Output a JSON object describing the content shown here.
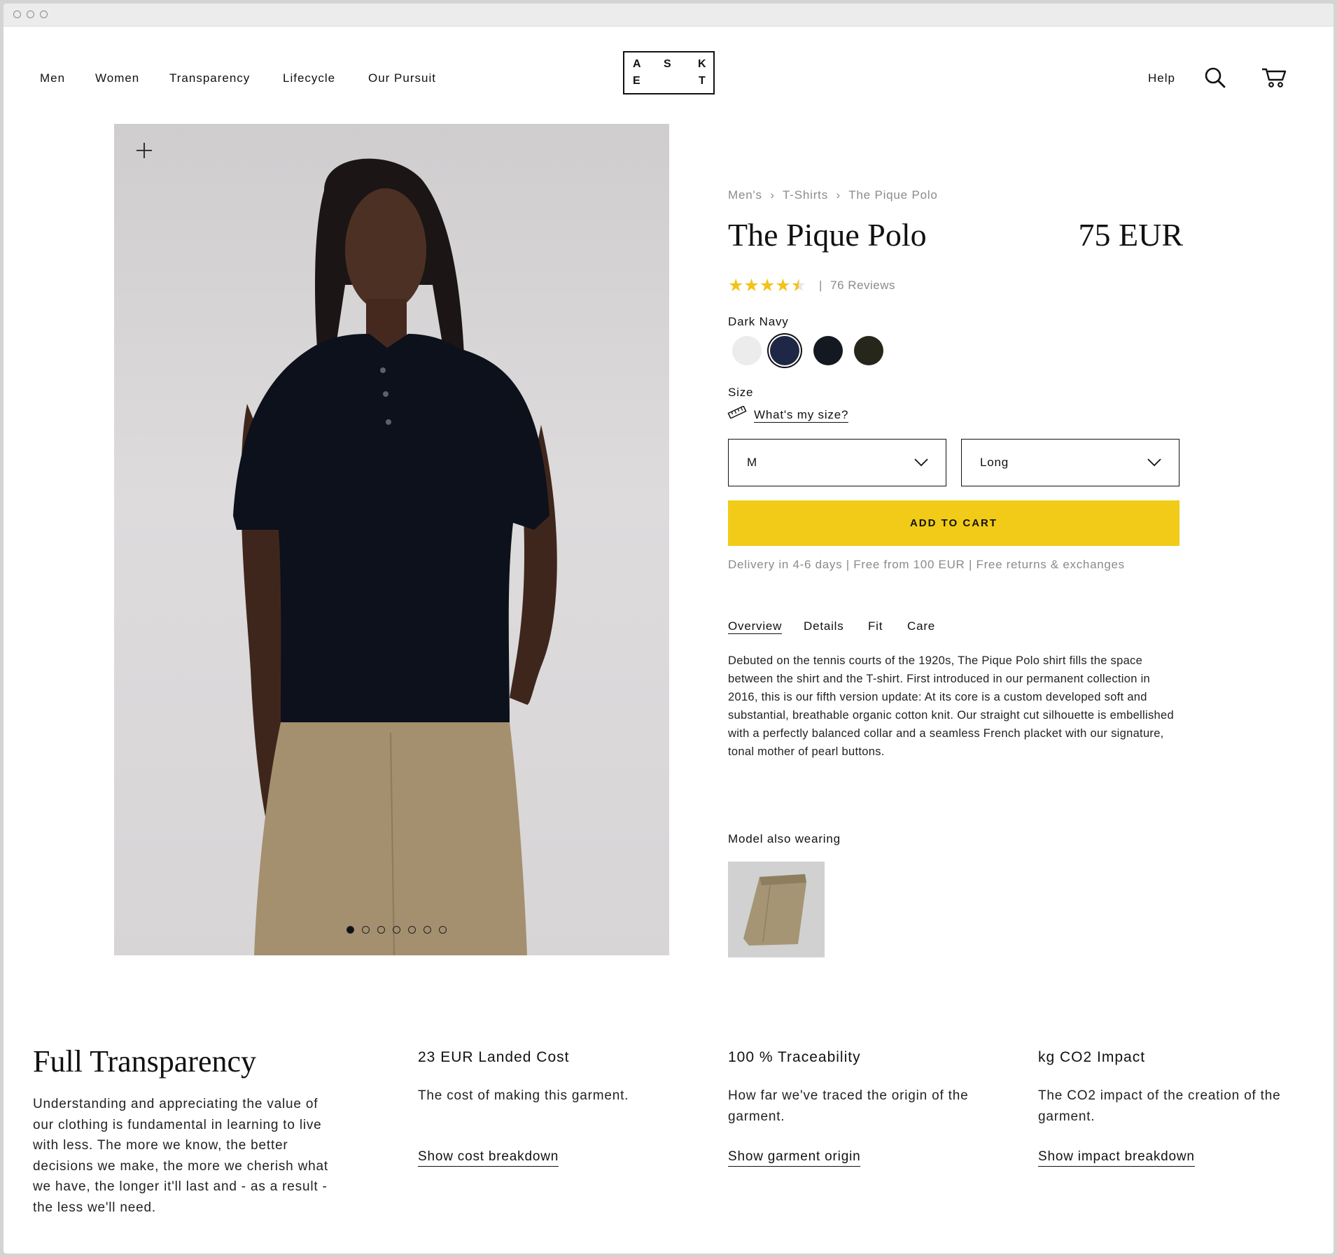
{
  "nav": {
    "links": [
      "Men",
      "Women",
      "Transparency",
      "Lifecycle",
      "Our Pursuit"
    ],
    "help": "Help",
    "search_icon": "search-icon",
    "cart_icon": "cart-icon"
  },
  "logo": {
    "letters": [
      "A",
      "S",
      "K",
      "E",
      "T"
    ]
  },
  "breadcrumb": {
    "items": [
      "Men's",
      "T-Shirts",
      "The Pique Polo"
    ],
    "separator": "›"
  },
  "product": {
    "title": "The Pique Polo",
    "price": "75 EUR",
    "rating_stars": 4.5,
    "reviews": "76 Reviews",
    "review_separator": "|",
    "color_label": "Dark Navy",
    "swatches": [
      {
        "name": "Off White",
        "color": "#ececec",
        "selected": false
      },
      {
        "name": "Dark Navy",
        "color": "#1e2745",
        "selected": true
      },
      {
        "name": "Black",
        "color": "#141820",
        "selected": false
      },
      {
        "name": "Dark Olive",
        "color": "#26261a",
        "selected": false
      }
    ],
    "size_label": "Size",
    "size_guide": "What's my size?",
    "size_value": "M",
    "length_value": "Long",
    "add_to_cart": "ADD TO CART",
    "delivery": "Delivery in 4-6 days | Free from 100 EUR | Free returns & exchanges",
    "tabs": [
      "Overview",
      "Details",
      "Fit",
      "Care"
    ],
    "active_tab": "Overview",
    "description": "Debuted on the tennis courts of the 1920s, The Pique Polo shirt fills the space between the shirt and the T-shirt. First introduced in our permanent collection in 2016, this is our fifth version update: At its core is a custom developed soft and substantial, breathable organic cotton knit. Our straight cut silhouette is embellished with a perfectly balanced collar and a seamless French placket with our signature, tonal mother of pearl buttons.",
    "model_also_wearing": "Model also wearing",
    "gallery": {
      "total": 7,
      "current": 1
    }
  },
  "transparency": {
    "title": "Full Transparency",
    "body": "Understanding and appreciating the value of our clothing is fundamental in learning to live with less. The more we know, the better decisions we make, the more we cherish what we have, the longer it'll last and - as a result - the less we'll need.",
    "columns": [
      {
        "heading": "23 EUR Landed Cost",
        "text": "The cost of making this garment.",
        "link": "Show cost breakdown"
      },
      {
        "heading": "100 % Traceability",
        "text": "How far we've traced the origin of the garment.",
        "link": "Show garment origin"
      },
      {
        "heading": "kg CO2 Impact",
        "text": "The CO2 impact of the creation of the garment.",
        "link": "Show impact breakdown"
      }
    ]
  },
  "colors": {
    "accent": "#f1cb17",
    "star": "#f2c31b",
    "muted": "#8b8b8b"
  }
}
